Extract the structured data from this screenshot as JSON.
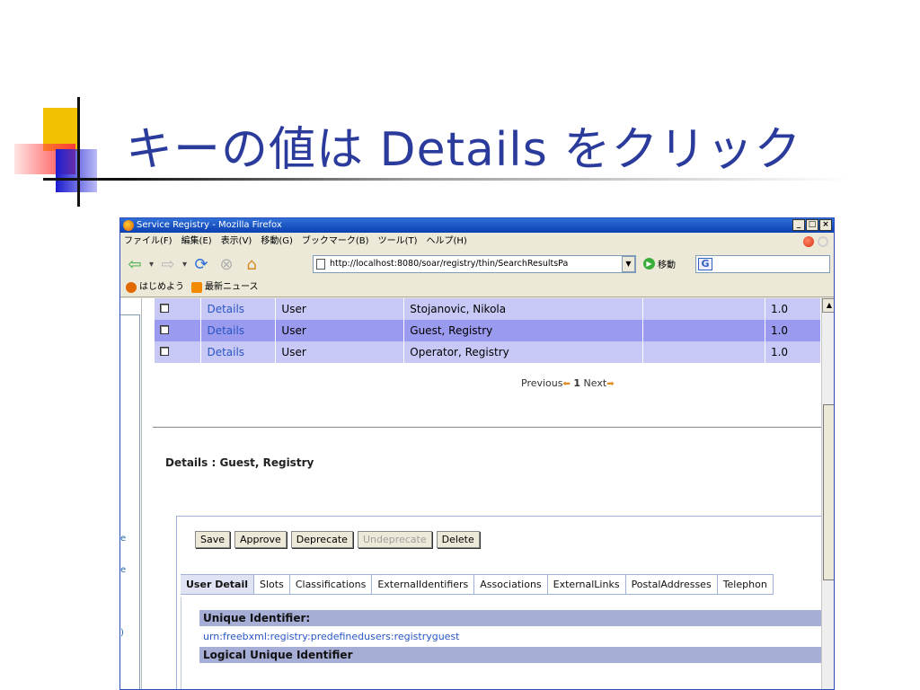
{
  "slide": {
    "title": "キーの値は Details をクリック"
  },
  "window": {
    "title": "Service Registry - Mozilla Firefox",
    "menu": [
      "ファイル(F)",
      "編集(E)",
      "表示(V)",
      "移動(G)",
      "ブックマーク(B)",
      "ツール(T)",
      "ヘルプ(H)"
    ],
    "url": "http://localhost:8080/soar/registry/thin/SearchResultsPa",
    "go_label": "移動",
    "bookmarks": [
      "はじめよう",
      "最新ニュース"
    ]
  },
  "results": {
    "rows": [
      {
        "link": "Details",
        "type": "User",
        "name": "Stojanovic, Nikola",
        "extra": "",
        "version": "1.0"
      },
      {
        "link": "Details",
        "type": "User",
        "name": "Guest, Registry",
        "extra": "",
        "version": "1.0"
      },
      {
        "link": "Details",
        "type": "User",
        "name": "Operator, Registry",
        "extra": "",
        "version": "1.0"
      }
    ],
    "pager": {
      "previous": "Previous",
      "page": "1",
      "next": "Next"
    }
  },
  "details": {
    "heading": "Details : Guest, Registry",
    "buttons": {
      "save": "Save",
      "approve": "Approve",
      "deprecate": "Deprecate",
      "undeprecate": "Undeprecate",
      "delete": "Delete"
    },
    "tabs": [
      "User Detail",
      "Slots",
      "Classifications",
      "ExternalIdentifiers",
      "Associations",
      "ExternalLinks",
      "PostalAddresses",
      "Telephon"
    ],
    "active_tab": "User Detail",
    "fields": [
      {
        "label": "Unique Identifier:",
        "value": "urn:freebxml:registry:predefinedusers:registryguest"
      },
      {
        "label": "Logical Unique Identifier",
        "value": ""
      }
    ]
  },
  "left_frame_chars": [
    "e",
    "e",
    ")"
  ],
  "colors": {
    "title": "#2b3b9c",
    "row_light": "#c8c8f6",
    "row_selected": "#9a9aee",
    "link": "#2a55c5",
    "field_header": "#a6aed6"
  }
}
